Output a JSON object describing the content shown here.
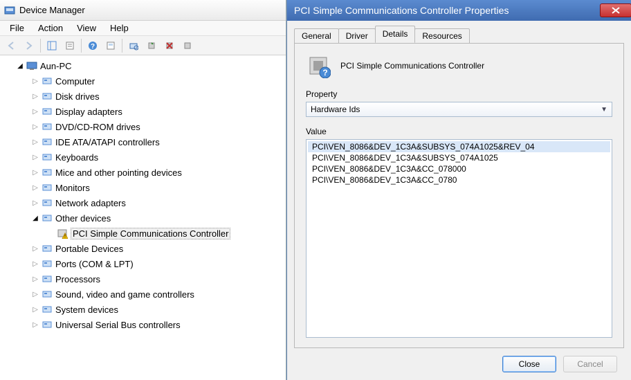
{
  "device_manager": {
    "title": "Device Manager",
    "menu": {
      "file": "File",
      "action": "Action",
      "view": "View",
      "help": "Help"
    },
    "toolbar_icons": {
      "back": "back-arrow-icon",
      "forward": "forward-arrow-icon",
      "show_hide": "show-hide-console-tree-icon",
      "help": "help-icon",
      "console_tree": "console-tree-icon",
      "properties": "properties-icon",
      "refresh": "refresh-icon",
      "update_driver": "update-driver-icon",
      "uninstall": "uninstall-icon",
      "scan": "scan-hardware-icon"
    },
    "tree": {
      "root": "Aun-PC",
      "nodes": [
        {
          "label": "Computer",
          "icon": "computer-icon"
        },
        {
          "label": "Disk drives",
          "icon": "disk-drive-icon"
        },
        {
          "label": "Display adapters",
          "icon": "display-adapter-icon"
        },
        {
          "label": "DVD/CD-ROM drives",
          "icon": "dvd-drive-icon"
        },
        {
          "label": "IDE ATA/ATAPI controllers",
          "icon": "ide-controller-icon"
        },
        {
          "label": "Keyboards",
          "icon": "keyboard-icon"
        },
        {
          "label": "Mice and other pointing devices",
          "icon": "mouse-icon"
        },
        {
          "label": "Monitors",
          "icon": "monitor-icon"
        },
        {
          "label": "Network adapters",
          "icon": "network-adapter-icon"
        },
        {
          "label": "Other devices",
          "icon": "other-devices-icon",
          "expanded": true,
          "children": [
            {
              "label": "PCI Simple Communications Controller",
              "icon": "unknown-device-icon",
              "selected": true
            }
          ]
        },
        {
          "label": "Portable Devices",
          "icon": "portable-device-icon"
        },
        {
          "label": "Ports (COM & LPT)",
          "icon": "port-icon"
        },
        {
          "label": "Processors",
          "icon": "processor-icon"
        },
        {
          "label": "Sound, video and game controllers",
          "icon": "sound-controller-icon"
        },
        {
          "label": "System devices",
          "icon": "system-device-icon"
        },
        {
          "label": "Universal Serial Bus controllers",
          "icon": "usb-controller-icon"
        }
      ]
    }
  },
  "properties_dialog": {
    "title": "PCI Simple Communications Controller Properties",
    "tabs": {
      "general": "General",
      "driver": "Driver",
      "details": "Details",
      "resources": "Resources",
      "active": "details"
    },
    "device_name": "PCI Simple Communications Controller",
    "property_label": "Property",
    "property_value": "Hardware Ids",
    "value_label": "Value",
    "values": [
      "PCI\\VEN_8086&DEV_1C3A&SUBSYS_074A1025&REV_04",
      "PCI\\VEN_8086&DEV_1C3A&SUBSYS_074A1025",
      "PCI\\VEN_8086&DEV_1C3A&CC_078000",
      "PCI\\VEN_8086&DEV_1C3A&CC_0780"
    ],
    "selected_value_index": 0,
    "buttons": {
      "close": "Close",
      "cancel": "Cancel"
    }
  }
}
